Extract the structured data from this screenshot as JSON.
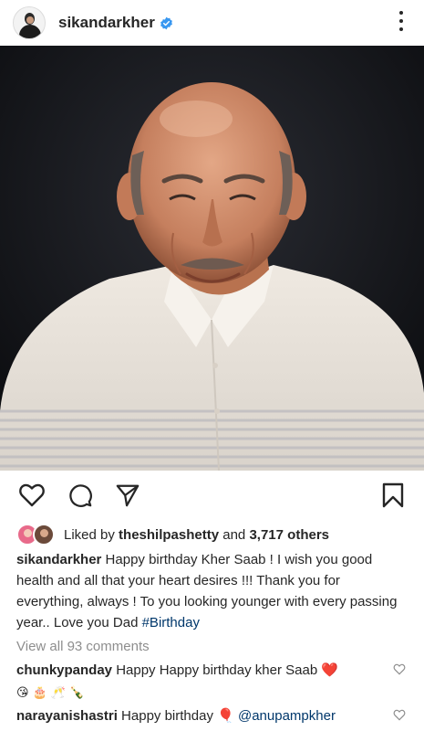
{
  "post": {
    "username": "sikandarkher",
    "verified_icon": "verified-badge-icon",
    "more_icon": "more-options-icon"
  },
  "photo": {
    "description_icon": "portrait-photo"
  },
  "actions": {
    "like_icon": "heart-outline-icon",
    "comment_icon": "comment-bubble-icon",
    "share_icon": "paper-plane-icon",
    "save_icon": "bookmark-icon"
  },
  "likes": {
    "prefix": "Liked by ",
    "user": "theshilpashetty",
    "middle": " and ",
    "count": "3,717 others"
  },
  "caption": {
    "username": "sikandarkher",
    "text": " Happy birthday Kher Saab ! I wish you good health and all that your heart desires !!! Thank you for everything, always ! To you looking younger with every passing year.. Love you Dad ",
    "hashtag": "#Birthday"
  },
  "view_all": "View all 93 comments",
  "comments": [
    {
      "username": "chunkypanday",
      "text": " Happy Happy birthday kher Saab ",
      "emoji": "❤️",
      "second_line_emojis": [
        "😘",
        "🎂",
        "🥂",
        "🍾"
      ]
    },
    {
      "username": "narayanishastri",
      "text": " Happy birthday ",
      "emoji": "🎈",
      "mention": "@anupampkher"
    }
  ],
  "colors": {
    "text": "#262626",
    "muted": "#8e8e8e",
    "link": "#00376b",
    "verified": "#3897f0"
  }
}
